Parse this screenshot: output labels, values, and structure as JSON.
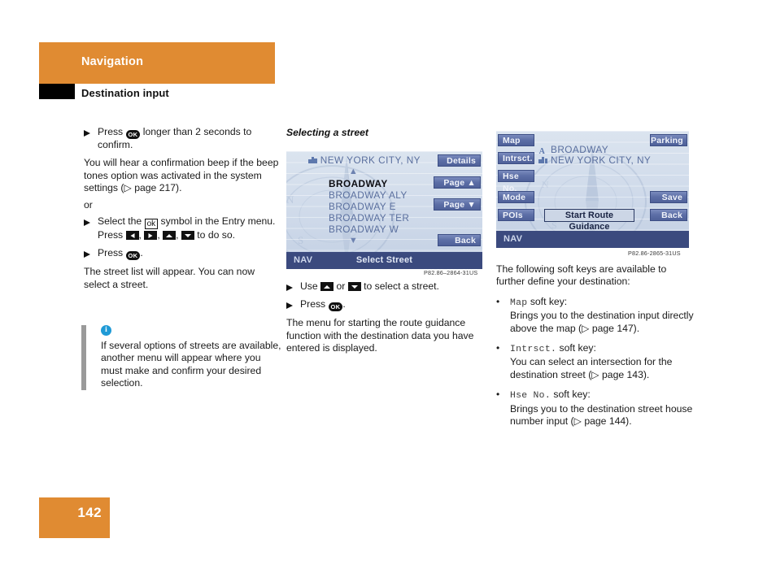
{
  "header": {
    "chapter": "Navigation",
    "section": "Destination input",
    "accent_color": "#e08b32"
  },
  "left_column": {
    "step1_pre": "Press",
    "step1_post": "longer than 2 seconds to confirm.",
    "step1_note": "You will hear a confirmation beep if the beep tones option was activated in the system settings (▷ page 217).",
    "or_label": "or",
    "step2_pre": "Select the",
    "step2_mid": "symbol in the Entry menu. Press",
    "step2_post": "to do so.",
    "step3_pre": "Press",
    "step3_post": ".",
    "step3_note": "The street list will appear. You can now select a street.",
    "ok_pill_label": "OK",
    "ok_box_label": "ok"
  },
  "note": {
    "icon": "info-icon",
    "text": "If several options of streets are available, another menu will appear where you must make and confirm your desired selection.",
    "icon_color": "#1f9ad6",
    "bar_color": "#9a9a9a"
  },
  "middle_column": {
    "subhead": "Selecting a street",
    "figure_code": "P82.86–2864-31US",
    "screen": {
      "city_label": "NEW YORK CITY, NY",
      "city_icon": "city-buildings-icon",
      "scroll_up_icon": "▲",
      "scroll_down_icon": "▼",
      "street_list": [
        {
          "label": "BROADWAY",
          "selected": true
        },
        {
          "label": "BROADWAY ALY",
          "selected": false
        },
        {
          "label": "BROADWAY E",
          "selected": false
        },
        {
          "label": "BROADWAY TER",
          "selected": false
        },
        {
          "label": "BROADWAY W",
          "selected": false
        }
      ],
      "soft_keys": [
        {
          "label": "Details",
          "name": "details"
        },
        {
          "label": "Page ▲",
          "name": "page-up"
        },
        {
          "label": "Page ▼",
          "name": "page-down"
        },
        {
          "label": "Back",
          "name": "back"
        }
      ],
      "status_left": "NAV",
      "status_title": "Select Street"
    },
    "steps": {
      "use_pre": "Use",
      "use_mid": "or",
      "use_post": "to select a street.",
      "press_pre": "Press",
      "press_post": ".",
      "press_note": "The menu for starting the route guidance function with the destination data you have entered is displayed."
    }
  },
  "right_column": {
    "figure_code": "P82.86-2865-31US",
    "screen": {
      "left_soft_keys": [
        {
          "label": "Map",
          "name": "map"
        },
        {
          "label": "Intrsct.",
          "name": "intersection"
        },
        {
          "label": "Hse No.",
          "name": "house-number"
        },
        {
          "label": "Mode",
          "name": "mode"
        },
        {
          "label": "POIs",
          "name": "pois"
        }
      ],
      "right_soft_keys": [
        {
          "label": "Parking",
          "name": "parking"
        },
        {
          "label": "Save",
          "name": "save"
        },
        {
          "label": "Back",
          "name": "back"
        }
      ],
      "destination_street": "BROADWAY",
      "destination_city": "NEW YORK CITY, NY",
      "street_icon": "road-sign-icon",
      "city_icon": "city-buildings-icon",
      "center_button": "Start Route Guidance",
      "status_left": "NAV"
    },
    "intro": "The following soft keys are available to further define your destination:",
    "bullets": [
      {
        "key": "Map",
        "key_suffix": "soft key:",
        "text": "Brings you to the destination input directly above the map (▷ page 147)."
      },
      {
        "key": "Intrsct.",
        "key_suffix": "soft key:",
        "text": "You can select an intersection for the destination street (▷ page 143)."
      },
      {
        "key": "Hse No.",
        "key_suffix": "soft key:",
        "text": "Brings you to the destination street house number input (▷ page 144)."
      }
    ]
  },
  "footer": {
    "page_number": "142"
  }
}
